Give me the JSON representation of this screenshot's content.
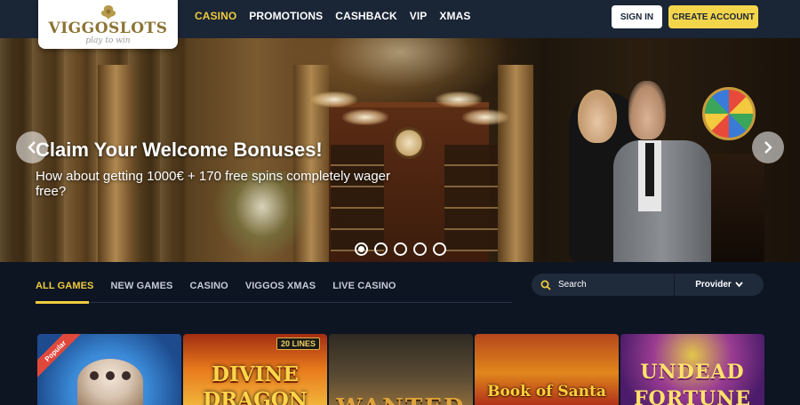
{
  "logo": {
    "name": "VIGGOSLOTS",
    "tagline": "play to win"
  },
  "nav": {
    "items": [
      {
        "label": "CASINO",
        "active": true
      },
      {
        "label": "PROMOTIONS",
        "active": false
      },
      {
        "label": "CASHBACK",
        "active": false
      },
      {
        "label": "VIP",
        "active": false
      },
      {
        "label": "XMAS",
        "active": false
      }
    ]
  },
  "header": {
    "signin_label": "SIGN IN",
    "create_label": "CREATE ACCOUNT"
  },
  "hero": {
    "title": "Claim Your Welcome Bonuses!",
    "subtitle": "How about getting 1000€ + 170 free spins completely wager free?",
    "slide_count": 5,
    "active_slide": 1
  },
  "filters": {
    "tabs": [
      {
        "label": "ALL GAMES",
        "active": true
      },
      {
        "label": "NEW GAMES",
        "active": false
      },
      {
        "label": "CASINO",
        "active": false
      },
      {
        "label": "VIGGOS XMAS",
        "active": false
      },
      {
        "label": "LIVE CASINO",
        "active": false
      }
    ]
  },
  "search": {
    "placeholder": "Search"
  },
  "provider": {
    "label": "Provider"
  },
  "games": [
    {
      "name": "",
      "badge": "Popular"
    },
    {
      "name_line1": "DIVINE",
      "name_line2": "DRAGON",
      "badge": "20 LINES"
    },
    {
      "name": "WANTED"
    },
    {
      "name": "Book of Santa"
    },
    {
      "name_line1": "UNDEAD",
      "name_line2": "FORTUNE"
    }
  ],
  "colors": {
    "header_bg": "#1a2536",
    "page_bg": "#0d1522",
    "accent_yellow": "#f0cb3c",
    "create_button": "#f3d54c",
    "search_bg": "#1f2a3b"
  }
}
